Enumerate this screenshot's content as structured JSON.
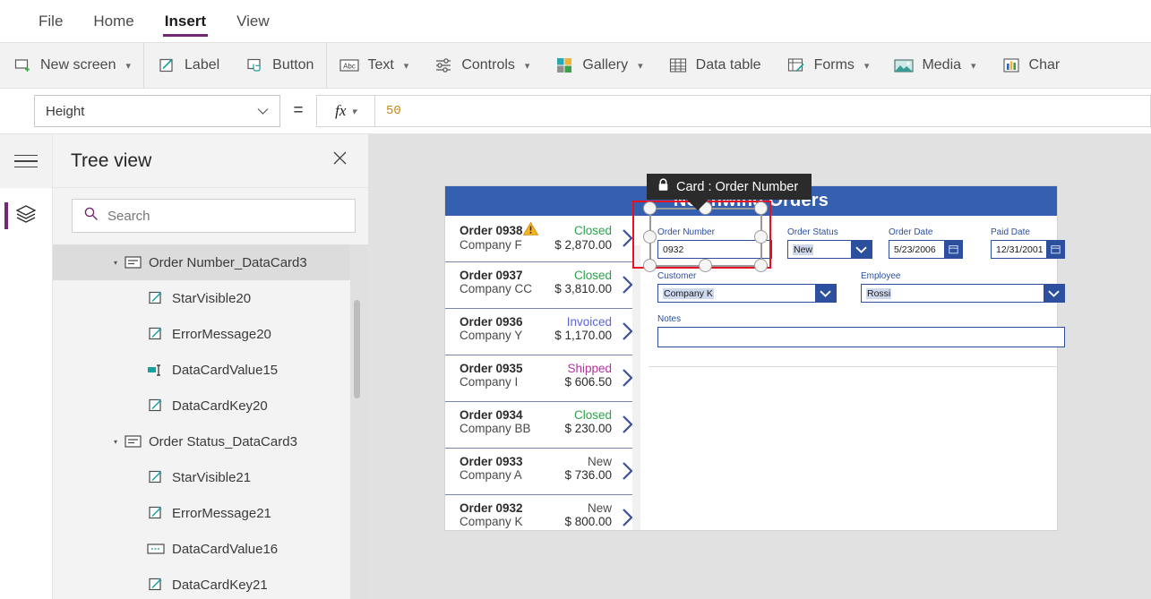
{
  "menu": {
    "items": [
      {
        "label": "File",
        "active": false
      },
      {
        "label": "Home",
        "active": false
      },
      {
        "label": "Insert",
        "active": true
      },
      {
        "label": "View",
        "active": false
      }
    ]
  },
  "ribbon": {
    "groups": [
      {
        "buttons": [
          {
            "icon": "new-screen-icon",
            "label": "New screen",
            "caret": true
          }
        ]
      },
      {
        "buttons": [
          {
            "icon": "label-icon",
            "label": "Label",
            "caret": false
          },
          {
            "icon": "button-icon",
            "label": "Button",
            "caret": false
          }
        ]
      },
      {
        "buttons": [
          {
            "icon": "text-icon",
            "label": "Text",
            "caret": true
          },
          {
            "icon": "controls-icon",
            "label": "Controls",
            "caret": true
          },
          {
            "icon": "gallery-icon",
            "label": "Gallery",
            "caret": true
          },
          {
            "icon": "data-table-icon",
            "label": "Data table",
            "caret": false
          },
          {
            "icon": "forms-icon",
            "label": "Forms",
            "caret": true
          },
          {
            "icon": "media-icon",
            "label": "Media",
            "caret": true
          },
          {
            "icon": "charts-icon",
            "label": "Char",
            "caret": false
          }
        ]
      }
    ]
  },
  "formula_bar": {
    "property": "Height",
    "equals": "=",
    "fx_label": "fx",
    "value": "50"
  },
  "sidebar_rail": {
    "menu_icon": "hamburger-icon",
    "items": [
      {
        "icon": "layers-icon",
        "active": true
      }
    ]
  },
  "tree_view": {
    "title": "Tree view",
    "close_icon": "close-icon",
    "search": {
      "placeholder": "Search",
      "icon": "search-icon",
      "value": ""
    },
    "rows": [
      {
        "label": "Order Number_DataCard3",
        "indent": 1,
        "icon": "datacard-icon",
        "expander": true,
        "selected": true
      },
      {
        "label": "StarVisible20",
        "indent": 2,
        "icon": "label-control-icon",
        "expander": false,
        "selected": false
      },
      {
        "label": "ErrorMessage20",
        "indent": 2,
        "icon": "label-control-icon",
        "expander": false,
        "selected": false
      },
      {
        "label": "DataCardValue15",
        "indent": 2,
        "icon": "textinput-control-icon",
        "expander": false,
        "selected": false
      },
      {
        "label": "DataCardKey20",
        "indent": 2,
        "icon": "label-control-icon",
        "expander": false,
        "selected": false
      },
      {
        "label": "Order Status_DataCard3",
        "indent": 1,
        "icon": "datacard-icon",
        "expander": true,
        "selected": false
      },
      {
        "label": "StarVisible21",
        "indent": 2,
        "icon": "label-control-icon",
        "expander": false,
        "selected": false
      },
      {
        "label": "ErrorMessage21",
        "indent": 2,
        "icon": "label-control-icon",
        "expander": false,
        "selected": false
      },
      {
        "label": "DataCardValue16",
        "indent": 2,
        "icon": "dropdown-control-icon",
        "expander": false,
        "selected": false
      },
      {
        "label": "DataCardKey21",
        "indent": 2,
        "icon": "label-control-icon",
        "expander": false,
        "selected": false
      }
    ]
  },
  "canvas": {
    "app_title": "Northwind Orders",
    "banner_color": "#3560b0",
    "selection": {
      "tooltip_label": "Card : Order Number",
      "tooltip_icon": "lock-icon",
      "outline_color": "#e81123"
    },
    "gallery": {
      "items": [
        {
          "order": "Order 0938",
          "warning": true,
          "status": "Closed",
          "status_color": "#2ba24c",
          "company": "Company F",
          "amount": "$ 2,870.00"
        },
        {
          "order": "Order 0937",
          "warning": false,
          "status": "Closed",
          "status_color": "#2ba24c",
          "company": "Company CC",
          "amount": "$ 3,810.00"
        },
        {
          "order": "Order 0936",
          "warning": false,
          "status": "Invoiced",
          "status_color": "#5b64d8",
          "company": "Company Y",
          "amount": "$ 1,170.00"
        },
        {
          "order": "Order 0935",
          "warning": false,
          "status": "Shipped",
          "status_color": "#b5329b",
          "company": "Company I",
          "amount": "$ 606.50"
        },
        {
          "order": "Order 0934",
          "warning": false,
          "status": "Closed",
          "status_color": "#2ba24c",
          "company": "Company BB",
          "amount": "$ 230.00"
        },
        {
          "order": "Order 0933",
          "warning": false,
          "status": "New",
          "status_color": "#4a4a4a",
          "company": "Company A",
          "amount": "$ 736.00"
        },
        {
          "order": "Order 0932",
          "warning": false,
          "status": "New",
          "status_color": "#4a4a4a",
          "company": "Company K",
          "amount": "$ 800.00"
        }
      ]
    },
    "form": {
      "order_number": {
        "label": "Order Number",
        "value": "0932"
      },
      "order_status": {
        "label": "Order Status",
        "value": "New"
      },
      "order_date": {
        "label": "Order Date",
        "value": "5/23/2006"
      },
      "paid_date": {
        "label": "Paid Date",
        "value": "12/31/2001"
      },
      "customer": {
        "label": "Customer",
        "value": "Company K"
      },
      "employee": {
        "label": "Employee",
        "value": "Rossi"
      },
      "notes": {
        "label": "Notes",
        "value": ""
      }
    }
  }
}
